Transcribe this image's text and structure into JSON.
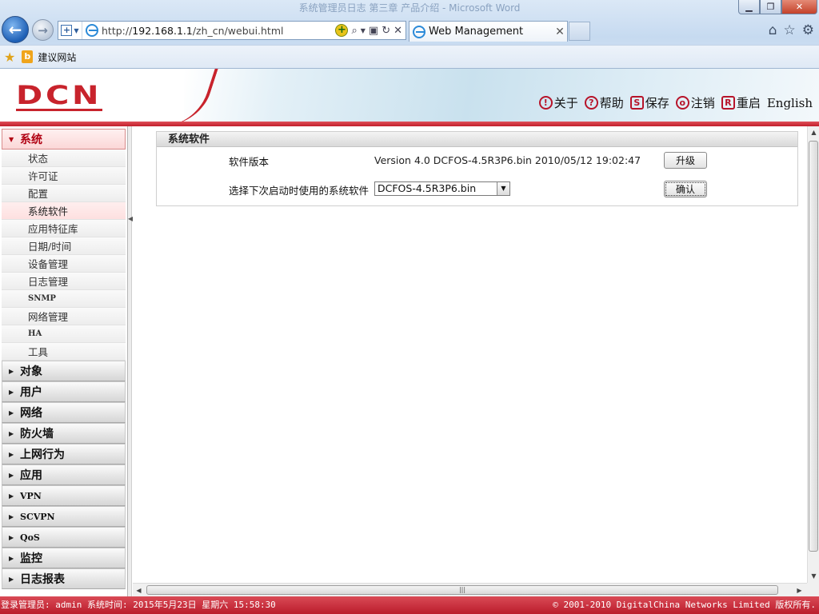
{
  "browser": {
    "window_title": "系统管理员日志 第三章 产品介绍 - Microsoft Word",
    "url_prefix": "http://",
    "url_host": "192.168.1.1",
    "url_path": "/zh_cn/webui.html",
    "tab_title": "Web Management",
    "favorite_link": "建议网站"
  },
  "header": {
    "logo": "DCN",
    "menu": [
      {
        "label": "关于",
        "icon": "!"
      },
      {
        "label": "帮助",
        "icon": "?"
      },
      {
        "label": "保存",
        "icon": "S"
      },
      {
        "label": "注销",
        "icon": "o"
      },
      {
        "label": "重启",
        "icon": "R"
      },
      {
        "label": "English",
        "icon": ""
      }
    ]
  },
  "sidebar": {
    "open_category": "系统",
    "sub_items": [
      "状态",
      "许可证",
      "配置",
      "系统软件",
      "应用特征库",
      "日期/时间",
      "设备管理",
      "日志管理",
      "SNMP",
      "网络管理",
      "HA",
      "工具"
    ],
    "active_sub_item": "系统软件",
    "categories": [
      "对象",
      "用户",
      "网络",
      "防火墙",
      "上网行为",
      "应用",
      "VPN",
      "SCVPN",
      "QoS",
      "监控",
      "日志报表"
    ]
  },
  "panel": {
    "title": "系统软件",
    "version_label": "软件版本",
    "version_value": "Version 4.0 DCFOS-4.5R3P6.bin 2010/05/12 19:02:47",
    "upgrade_button": "升级",
    "boot_label": "选择下次启动时使用的系统软件",
    "boot_selected": "DCFOS-4.5R3P6.bin",
    "confirm_button": "确认"
  },
  "status": {
    "left": "登录管理员: admin 系统时间: 2015年5月23日 星期六 15:58:30",
    "right": "© 2001-2010 DigitalChina Networks Limited 版权所有."
  },
  "colors": {
    "brand_red": "#c8232c",
    "chrome_blue": "#c6daf0",
    "active_highlight": "#fde0e0"
  }
}
